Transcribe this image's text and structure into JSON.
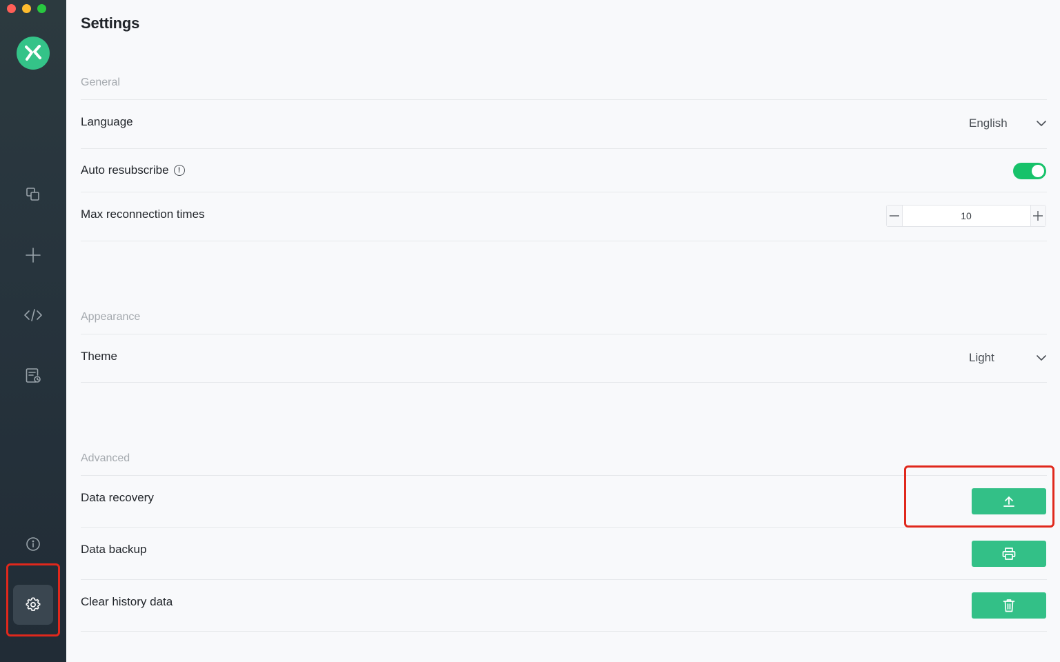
{
  "window": {
    "title": "Settings"
  },
  "sidebar": {
    "logo": "mqttx-logo-icon",
    "items": [
      {
        "name": "connections",
        "icon": "connections-icon"
      },
      {
        "name": "new-connection",
        "icon": "plus-icon"
      },
      {
        "name": "script",
        "icon": "code-icon"
      },
      {
        "name": "log",
        "icon": "log-icon"
      },
      {
        "name": "about",
        "icon": "info-icon"
      },
      {
        "name": "settings",
        "icon": "gear-icon",
        "active": true
      }
    ]
  },
  "sections": {
    "general": {
      "title": "General",
      "language_label": "Language",
      "language_value": "English",
      "auto_resub_label": "Auto resubscribe",
      "auto_resub_info_icon": "!",
      "auto_resub_enabled": true,
      "max_reconnect_label": "Max reconnection times",
      "max_reconnect_value": "10"
    },
    "appearance": {
      "title": "Appearance",
      "theme_label": "Theme",
      "theme_value": "Light"
    },
    "advanced": {
      "title": "Advanced",
      "data_recovery_label": "Data recovery",
      "data_backup_label": "Data backup",
      "clear_history_label": "Clear history data"
    }
  },
  "colors": {
    "accent": "#33c087",
    "toggle_on": "#17c26a",
    "sidebar_bg": "#27343d",
    "highlight": "#e0281c"
  }
}
